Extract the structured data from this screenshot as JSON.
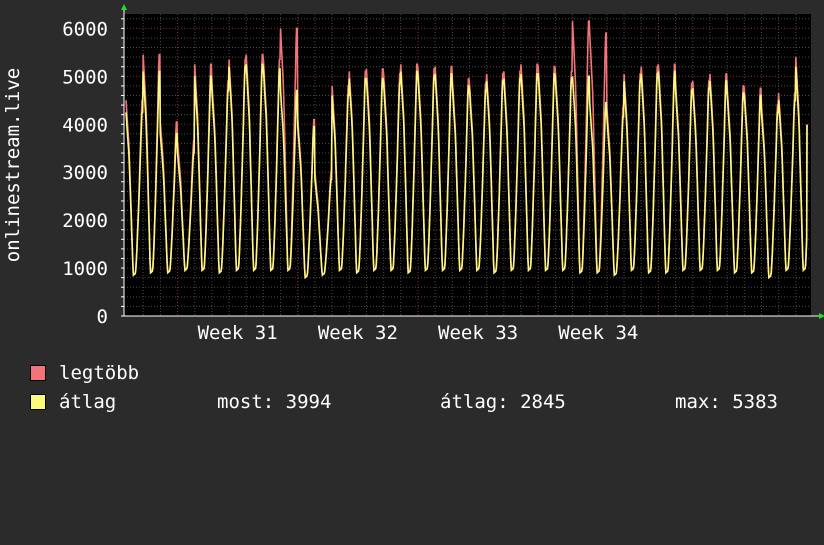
{
  "chart_data": {
    "type": "line",
    "ylabel": "onlinestream.live",
    "ylim": [
      0,
      6300
    ],
    "yticks": [
      0,
      1000,
      2000,
      3000,
      4000,
      5000,
      6000
    ],
    "x_week_labels": [
      "Week 31",
      "Week 32",
      "Week 33",
      "Week 34"
    ],
    "grid": true,
    "legend_position": "bottom",
    "series": [
      {
        "name": "legtöbb",
        "color": "#f2737a",
        "daily_peaks": [
          4500,
          5450,
          4050,
          3650,
          5250,
          4900,
          5350,
          5450,
          5350,
          6000,
          4100,
          3000,
          4800,
          5100,
          5150,
          5050,
          5250,
          5150,
          5200,
          4950,
          4850,
          5050,
          5100,
          5250,
          5200,
          5100,
          6150,
          5900,
          4350,
          5050,
          5200,
          5250,
          4850,
          4900,
          5050,
          4800,
          4750,
          4400,
          4650,
          5400
        ],
        "daily_troughs": [
          850,
          900,
          900,
          950,
          950,
          900,
          950,
          950,
          950,
          950,
          800,
          850,
          950,
          900,
          950,
          950,
          900,
          950,
          950,
          950,
          950,
          900,
          950,
          950,
          950,
          950,
          900,
          900,
          850,
          950,
          900,
          900,
          950,
          950,
          950,
          900,
          900,
          800,
          950,
          950
        ]
      },
      {
        "name": "átlag",
        "color": "#fafa7f",
        "daily_peaks": [
          4250,
          5100,
          3800,
          3400,
          5000,
          4700,
          5200,
          5250,
          5150,
          4700,
          3950,
          2850,
          4600,
          4950,
          4950,
          4850,
          5100,
          5000,
          5050,
          4800,
          4700,
          4900,
          4950,
          5050,
          5050,
          4950,
          5000,
          4450,
          4150,
          4900,
          5050,
          5100,
          4700,
          4750,
          4900,
          4650,
          4600,
          4250,
          4500,
          5200
        ],
        "daily_troughs": [
          850,
          900,
          900,
          950,
          950,
          900,
          950,
          950,
          950,
          950,
          800,
          850,
          950,
          900,
          950,
          950,
          900,
          950,
          950,
          950,
          950,
          900,
          950,
          950,
          950,
          950,
          900,
          900,
          850,
          950,
          900,
          900,
          950,
          950,
          950,
          900,
          900,
          800,
          950,
          950
        ]
      }
    ],
    "last_value": 3994
  },
  "legend": {
    "max_label": "legtöbb",
    "avg_label": "átlag",
    "max_color": "#f2737a",
    "avg_color": "#fafa7f",
    "stats": [
      {
        "label": "most:",
        "value": "3994"
      },
      {
        "label": "átlag:",
        "value": "2845"
      },
      {
        "label": "max:",
        "value": "5383"
      }
    ]
  }
}
